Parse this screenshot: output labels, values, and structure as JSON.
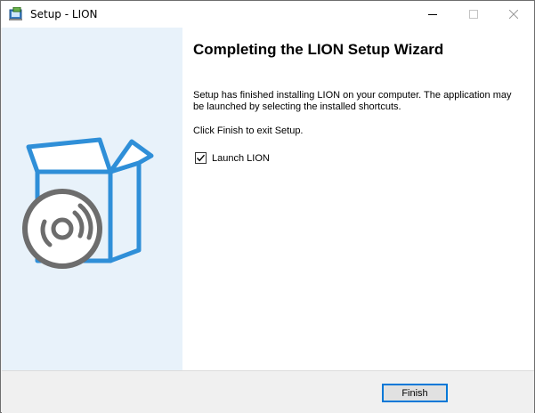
{
  "window": {
    "title": "Setup - LION",
    "icons": {
      "app": "setup-app-icon",
      "minimize": "minimize-icon",
      "maximize": "maximize-icon",
      "close": "close-icon"
    }
  },
  "sidebar": {
    "art": "box-with-disc-illustration"
  },
  "content": {
    "heading": "Completing the LION Setup Wizard",
    "paragraph1": "Setup has finished installing LION on your computer. The application may be launched by selecting the installed shortcuts.",
    "paragraph2": "Click Finish to exit Setup.",
    "launch_checkbox": {
      "label": "Launch LION",
      "checked": true
    }
  },
  "footer": {
    "finish_label": "Finish"
  },
  "colors": {
    "accent": "#0078d7",
    "sidebar_bg": "#e8f2fa",
    "art_blue": "#2f8fd8",
    "art_gray": "#6d6d6d"
  }
}
